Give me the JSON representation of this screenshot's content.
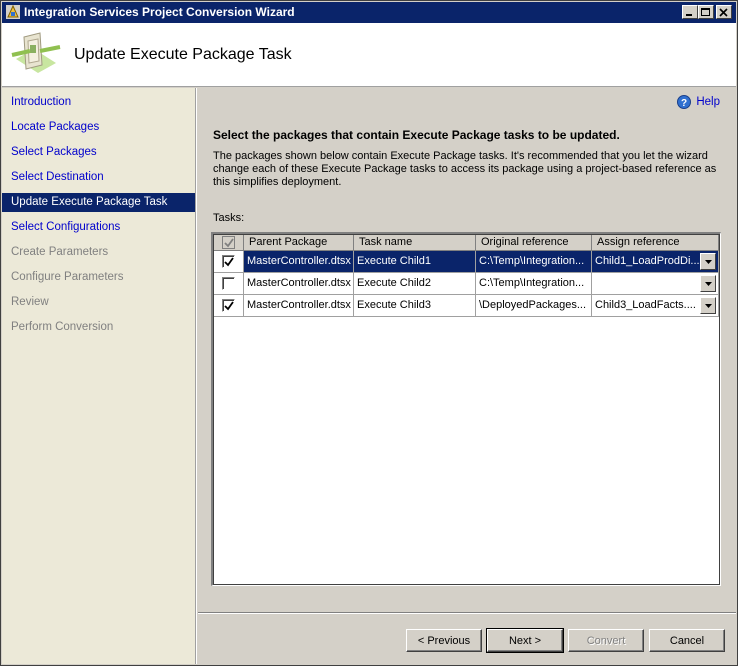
{
  "window": {
    "title": "Integration Services Project Conversion Wizard"
  },
  "header": {
    "title": "Update Execute Package Task"
  },
  "nav": {
    "items": [
      {
        "label": "Introduction",
        "state": "link"
      },
      {
        "label": "Locate Packages",
        "state": "link"
      },
      {
        "label": "Select Packages",
        "state": "link"
      },
      {
        "label": "Select Destination",
        "state": "link"
      },
      {
        "label": "Update Execute Package Task",
        "state": "selected"
      },
      {
        "label": "Select Configurations",
        "state": "link"
      },
      {
        "label": "Create Parameters",
        "state": "disabled"
      },
      {
        "label": "Configure Parameters",
        "state": "disabled"
      },
      {
        "label": "Review",
        "state": "disabled"
      },
      {
        "label": "Perform Conversion",
        "state": "disabled"
      }
    ]
  },
  "main": {
    "help_label": "Help",
    "heading": "Select the packages that contain Execute Package tasks to be updated.",
    "description": "The packages shown below contain Execute Package tasks. It's recommended that you let the wizard change each of these Execute Package tasks to access its package using a project-based reference as this simplifies deployment.",
    "tasks_label": "Tasks:"
  },
  "grid": {
    "columns": [
      "Parent Package",
      "Task name",
      "Original reference",
      "Assign reference"
    ],
    "rows": [
      {
        "checked": true,
        "parent": "MasterController.dtsx",
        "task": "Execute Child1",
        "original": "C:\\Temp\\Integration...",
        "assign": "Child1_LoadProdDi...",
        "selected": true
      },
      {
        "checked": false,
        "parent": "MasterController.dtsx",
        "task": "Execute Child2",
        "original": "C:\\Temp\\Integration...",
        "assign": "",
        "selected": false
      },
      {
        "checked": true,
        "parent": "MasterController.dtsx",
        "task": "Execute Child3",
        "original": "\\DeployedPackages...",
        "assign": "Child3_LoadFacts....",
        "selected": false
      }
    ]
  },
  "buttons": {
    "previous": "< Previous",
    "next": "Next >",
    "convert": "Convert",
    "cancel": "Cancel"
  }
}
